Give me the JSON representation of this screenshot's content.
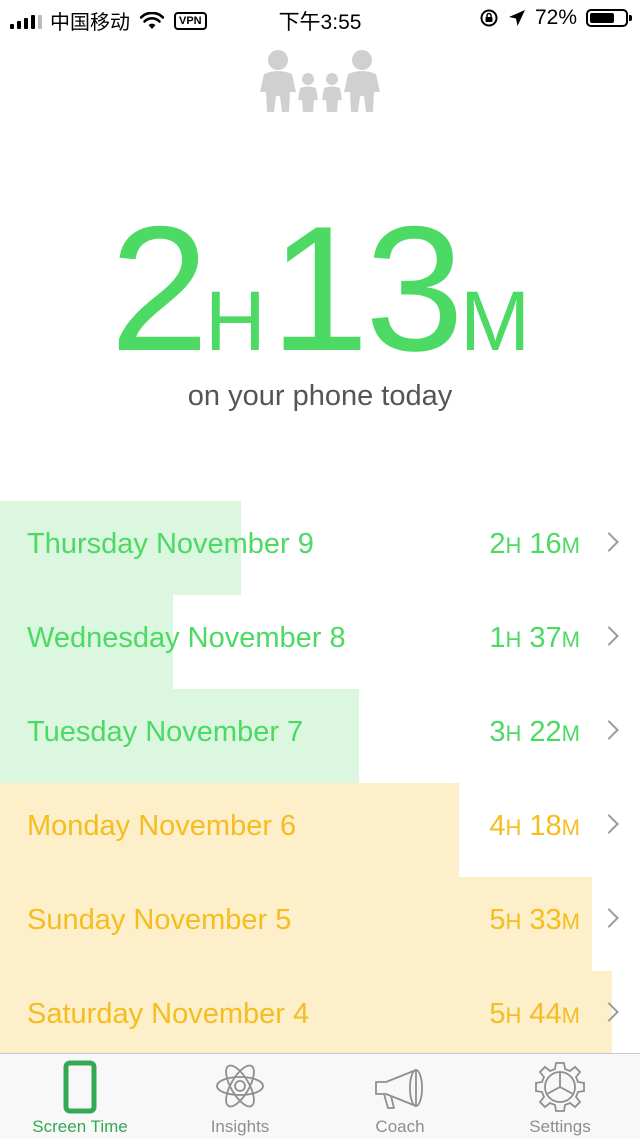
{
  "status_bar": {
    "carrier": "中国移动",
    "vpn": "VPN",
    "time": "下午3:55",
    "battery_percent": "72%",
    "battery_level": 0.72
  },
  "header": {
    "icon": "family-icon"
  },
  "today": {
    "hours": "2",
    "hours_unit": "H",
    "minutes": "13",
    "minutes_unit": "M",
    "caption": "on your phone today"
  },
  "days": [
    {
      "label": "Thursday November 9",
      "h": "2",
      "m": "16",
      "fill": 0.377,
      "tone": "green"
    },
    {
      "label": "Wednesday November 8",
      "h": "1",
      "m": "37",
      "fill": 0.27,
      "tone": "green"
    },
    {
      "label": "Tuesday November 7",
      "h": "3",
      "m": "22",
      "fill": 0.561,
      "tone": "green"
    },
    {
      "label": "Monday November 6",
      "h": "4",
      "m": "18",
      "fill": 0.717,
      "tone": "orange"
    },
    {
      "label": "Sunday November 5",
      "h": "5",
      "m": "33",
      "fill": 0.925,
      "tone": "orange"
    },
    {
      "label": "Saturday November 4",
      "h": "5",
      "m": "44",
      "fill": 0.956,
      "tone": "orange"
    }
  ],
  "units": {
    "h": "H",
    "m": "M"
  },
  "colors": {
    "green_text": "#4cd964",
    "green_bar": "#dcf7df",
    "orange_text": "#f5bd1f",
    "orange_bar": "#fdefc9",
    "accent": "#34a853"
  },
  "tabs": [
    {
      "label": "Screen Time",
      "icon": "phone-icon",
      "active": true
    },
    {
      "label": "Insights",
      "icon": "atom-icon",
      "active": false
    },
    {
      "label": "Coach",
      "icon": "megaphone-icon",
      "active": false
    },
    {
      "label": "Settings",
      "icon": "gear-icon",
      "active": false
    }
  ]
}
